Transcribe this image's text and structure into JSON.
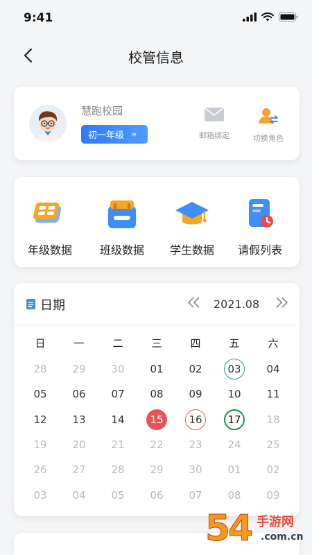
{
  "status_bar": {
    "time": "9:41"
  },
  "nav": {
    "title": "校管信息"
  },
  "profile": {
    "school_name": "慧跑校园",
    "grade": "初一年级",
    "grade_chevron": "»",
    "mail_label": "邮箱绑定",
    "switch_label": "切换角色"
  },
  "functions": [
    {
      "label": "年级数据",
      "icon": "grade-data-icon"
    },
    {
      "label": "班级数据",
      "icon": "class-data-icon"
    },
    {
      "label": "学生数据",
      "icon": "student-data-icon"
    },
    {
      "label": "请假列表",
      "icon": "leave-list-icon"
    }
  ],
  "calendar": {
    "title": "日期",
    "month": "2021.08",
    "prev_symbol": "《",
    "next_symbol": "》",
    "weekdays": [
      "日",
      "一",
      "二",
      "三",
      "四",
      "五",
      "六"
    ],
    "weeks": [
      [
        {
          "d": "28",
          "s": "muted"
        },
        {
          "d": "29",
          "s": "muted"
        },
        {
          "d": "30",
          "s": "muted"
        },
        {
          "d": "01",
          "s": ""
        },
        {
          "d": "02",
          "s": ""
        },
        {
          "d": "03",
          "s": "green"
        },
        {
          "d": "04",
          "s": ""
        }
      ],
      [
        {
          "d": "05",
          "s": ""
        },
        {
          "d": "06",
          "s": ""
        },
        {
          "d": "07",
          "s": ""
        },
        {
          "d": "08",
          "s": ""
        },
        {
          "d": "09",
          "s": ""
        },
        {
          "d": "10",
          "s": ""
        },
        {
          "d": "11",
          "s": ""
        }
      ],
      [
        {
          "d": "12",
          "s": ""
        },
        {
          "d": "13",
          "s": ""
        },
        {
          "d": "14",
          "s": ""
        },
        {
          "d": "15",
          "s": "today"
        },
        {
          "d": "16",
          "s": "red-ring"
        },
        {
          "d": "17",
          "s": "dark-green"
        },
        {
          "d": "18",
          "s": "muted"
        }
      ],
      [
        {
          "d": "19",
          "s": "muted"
        },
        {
          "d": "20",
          "s": "muted"
        },
        {
          "d": "21",
          "s": "muted"
        },
        {
          "d": "22",
          "s": "muted"
        },
        {
          "d": "23",
          "s": "muted"
        },
        {
          "d": "24",
          "s": "muted"
        },
        {
          "d": "25",
          "s": "muted"
        }
      ],
      [
        {
          "d": "26",
          "s": "muted"
        },
        {
          "d": "27",
          "s": "muted"
        },
        {
          "d": "28",
          "s": "muted"
        },
        {
          "d": "29",
          "s": "muted"
        },
        {
          "d": "30",
          "s": "muted"
        },
        {
          "d": "01",
          "s": "muted"
        },
        {
          "d": "02",
          "s": "muted"
        }
      ],
      [
        {
          "d": "03",
          "s": "muted"
        },
        {
          "d": "04",
          "s": "muted"
        },
        {
          "d": "05",
          "s": "muted"
        },
        {
          "d": "06",
          "s": "muted"
        },
        {
          "d": "07",
          "s": "muted"
        },
        {
          "d": "08",
          "s": "muted"
        },
        {
          "d": "09",
          "s": "muted"
        }
      ]
    ]
  },
  "watermark": {
    "big": "54",
    "line1": "手游网",
    "line2": ".com.cn"
  },
  "colors": {
    "accent": "#2e7bf6",
    "today": "#e85353",
    "marked": "#27a36a"
  }
}
